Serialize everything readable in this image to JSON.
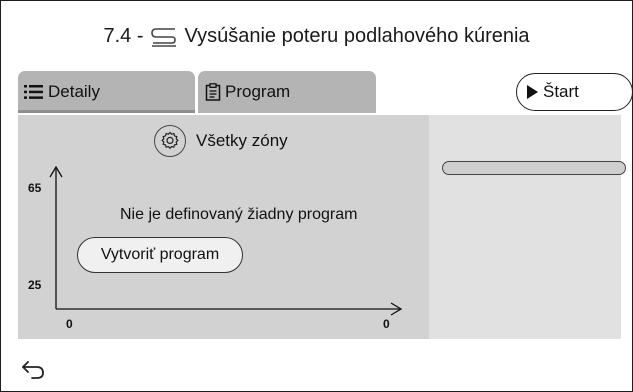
{
  "header": {
    "number": "7.4 -",
    "icon": "floor-heating-icon",
    "title": "Vysúšanie poteru podlahového kúrenia"
  },
  "tabs": [
    {
      "label": "Detaily",
      "icon": "list-icon",
      "active": true
    },
    {
      "label": "Program",
      "icon": "clipboard-icon",
      "active": false
    }
  ],
  "start_button": {
    "label": "Štart",
    "icon": "play-icon"
  },
  "zones": {
    "label": "Všetky zóny",
    "icon": "gear-icon"
  },
  "chart": {
    "y_top_tick": "65",
    "y_bottom_tick": "25",
    "x_left_tick": "0",
    "x_right_tick": "0"
  },
  "message": "Nie je definovaný žiadny program",
  "create_button": {
    "label": "Vytvoriť program"
  },
  "footer": {
    "back_icon": "back-arrow-icon"
  },
  "colors": {
    "tab_bg": "#b4b4b4",
    "panel_left": "#d2d2d2",
    "panel_right": "#e1e1e1",
    "border": "#1e1e1e"
  }
}
